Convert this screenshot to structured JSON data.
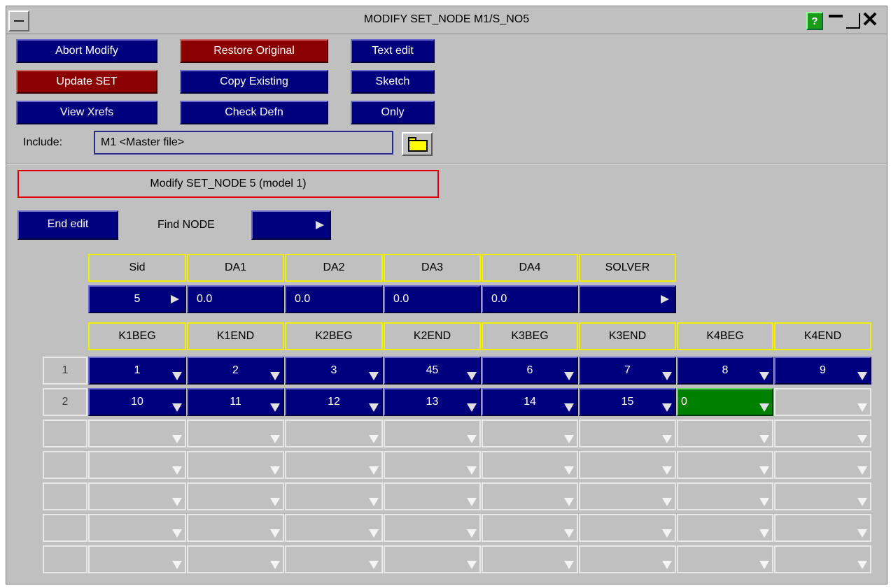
{
  "window": {
    "title": "MODIFY SET_NODE M1/S_NO5",
    "help_label": "?"
  },
  "buttons": {
    "abort_modify": "Abort Modify",
    "restore_original": "Restore Original",
    "text_edit": "Text edit",
    "update_set": "Update SET",
    "copy_existing": "Copy Existing",
    "sketch": "Sketch",
    "view_xrefs": "View Xrefs",
    "check_defn": "Check Defn",
    "only": "Only",
    "end_edit": "End edit"
  },
  "include": {
    "label": "Include:",
    "value": "M1  <Master file>"
  },
  "message": "Modify SET_NODE 5 (model 1)",
  "find": {
    "label": "Find NODE",
    "value": ""
  },
  "header_row1": [
    "Sid",
    "DA1",
    "DA2",
    "DA3",
    "DA4",
    "SOLVER"
  ],
  "values_row1": [
    "5",
    "0.0",
    "0.0",
    "0.0",
    "0.0",
    ""
  ],
  "header_row2": [
    "K1BEG",
    "K1END",
    "K2BEG",
    "K2END",
    "K3BEG",
    "K3END",
    "K4BEG",
    "K4END"
  ],
  "rows": [
    {
      "num": "1",
      "values": [
        "1",
        "2",
        "3",
        "45",
        "6",
        "7",
        "8",
        "9"
      ]
    },
    {
      "num": "2",
      "values": [
        "10",
        "11",
        "12",
        "13",
        "14",
        "15",
        "0",
        ""
      ]
    },
    {
      "num": "",
      "values": [
        "",
        "",
        "",
        "",
        "",
        "",
        "",
        ""
      ]
    },
    {
      "num": "",
      "values": [
        "",
        "",
        "",
        "",
        "",
        "",
        "",
        ""
      ]
    },
    {
      "num": "",
      "values": [
        "",
        "",
        "",
        "",
        "",
        "",
        "",
        ""
      ]
    },
    {
      "num": "",
      "values": [
        "",
        "",
        "",
        "",
        "",
        "",
        "",
        ""
      ]
    },
    {
      "num": "",
      "values": [
        "",
        "",
        "",
        "",
        "",
        "",
        "",
        ""
      ]
    }
  ],
  "colors": {
    "panel": "#c0c0c0",
    "button_blue": "#00007f",
    "button_red": "#8b0000",
    "active_cell": "#008000",
    "header_border": "#f0f000",
    "message_border": "#e00000"
  }
}
